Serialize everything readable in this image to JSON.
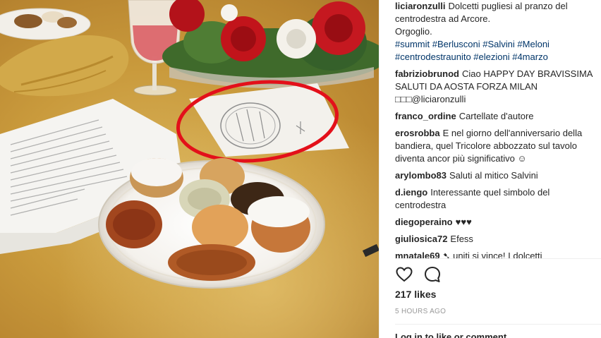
{
  "post": {
    "author": "liciaronzulli",
    "caption_lines": [
      "Dolcetti pugliesi al pranzo del",
      "centrodestra ad Arcore.",
      "Orgoglio."
    ],
    "hashtags_line1": "#summit #Berlusconi #Salvini #Meloni",
    "hashtags_line2": "#centrodestraunito #elezioni #4marzo"
  },
  "comments": [
    {
      "user": "fabriziobrunod",
      "text": "Ciao HAPPY DAY BRAVISSIMA SALUTI DA AOSTA FORZA MILAN □□□@liciaronzulli"
    },
    {
      "user": "franco_ordine",
      "text": "Cartellate d'autore"
    },
    {
      "user": "erosrobba",
      "text": "E nel giorno dell'anniversario della bandiera, quel Tricolore abbozzato sul tavolo diventa ancor più significativo ☺"
    },
    {
      "user": "arylombo83",
      "text": "Saluti al mitico Salvini"
    },
    {
      "user": "d.iengo",
      "text": "Interessante quel simbolo del centrodestra"
    },
    {
      "user": "diegoperaino",
      "text": "♥♥♥"
    },
    {
      "user": "giuliosica72",
      "text": "Efess"
    },
    {
      "user": "mnatale69",
      "text": "➷ uniti si vince! I dolcetti"
    }
  ],
  "icons": {
    "like": "heart-outline-icon",
    "comment": "speech-bubble-icon"
  },
  "stats": {
    "likes": "217 likes",
    "time": "5 HOURS AGO"
  },
  "footer": {
    "partial_text": "Log in to like or comment."
  },
  "colors": {
    "hashtag": "#003569",
    "highlight_circle": "#e3101a",
    "table_gold": "#c99a3c"
  }
}
